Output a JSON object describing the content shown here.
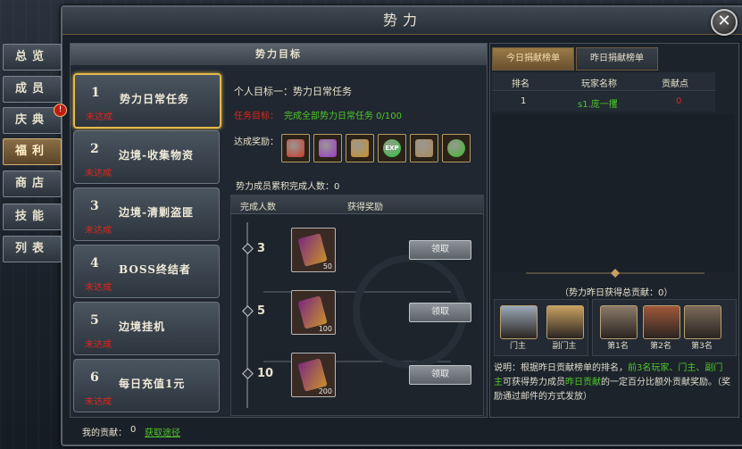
{
  "window": {
    "title": "势力",
    "close_glyph": "✕"
  },
  "side_tabs": [
    {
      "label": "总览"
    },
    {
      "label": "成员"
    },
    {
      "label": "庆典",
      "badge": "!"
    },
    {
      "label": "福利",
      "active": true
    },
    {
      "label": "商店"
    },
    {
      "label": "技能"
    },
    {
      "label": "列表"
    }
  ],
  "middle": {
    "header": "势力目标",
    "tasks": [
      {
        "num": "1",
        "name": "势力日常任务",
        "status": "未达成",
        "selected": true
      },
      {
        "num": "2",
        "name": "边境-收集物资",
        "status": "未达成"
      },
      {
        "num": "3",
        "name": "边境-清剿盗匪",
        "status": "未达成"
      },
      {
        "num": "4",
        "name": "BOSS终结者",
        "status": "未达成"
      },
      {
        "num": "5",
        "name": "边境挂机",
        "status": "未达成"
      },
      {
        "num": "6",
        "name": "每日充值1元",
        "status": "未达成"
      }
    ],
    "goal_title": "个人目标一：势力日常任务",
    "goal_label": "任务目标：",
    "goal_value": "完成全部势力日常任务 0/100",
    "reward_label": "达成奖励：",
    "reward_icons": [
      "gift-box-icon",
      "gem-box-icon",
      "gold-bag-icon",
      "exp-orb-icon",
      "token-card-icon",
      "green-orb-icon"
    ],
    "member_count": "势力成员累积完成人数：0",
    "table_headers": {
      "col1": "完成人数",
      "col2": "获得奖励"
    },
    "tiers": [
      {
        "count": "3",
        "reward_qty": "50",
        "button": "领取"
      },
      {
        "count": "5",
        "reward_qty": "100",
        "button": "领取"
      },
      {
        "count": "10",
        "reward_qty": "200",
        "button": "领取"
      }
    ]
  },
  "right": {
    "tabs": [
      {
        "label": "今日捐献榜单",
        "active": true
      },
      {
        "label": "昨日捐献榜单"
      }
    ],
    "headers": {
      "rank": "排名",
      "player": "玩家名称",
      "points": "贡献点"
    },
    "rows": [
      {
        "rank": "1",
        "player": "s1.庞一攫",
        "points": "0"
      }
    ],
    "total": "（势力昨日获得总贡献：0）",
    "chests": [
      {
        "label": "门主",
        "color": "#9aa8b8"
      },
      {
        "label": "副门主",
        "color": "#c8a060"
      },
      {
        "label": "第1名",
        "color": "#8a7a6a"
      },
      {
        "label": "第2名",
        "color": "#a0583a"
      },
      {
        "label": "第3名",
        "color": "#7a6a5a"
      }
    ],
    "note_parts": [
      {
        "text": "说明：根据昨日贡献榜单的排名，",
        "color": "#e0dccc"
      },
      {
        "text": "前3名玩家、门主、副门主",
        "color": "#4fc82a"
      },
      {
        "text": "可获得势力成员",
        "color": "#e0dccc"
      },
      {
        "text": "昨日贡献",
        "color": "#4fc82a"
      },
      {
        "text": "的一定百分比额外贡献奖励。（奖励通过邮件的方式发放）",
        "color": "#e0dccc"
      }
    ]
  },
  "footer": {
    "label": "我的贡献：",
    "value": "0",
    "link": "获取途径"
  }
}
